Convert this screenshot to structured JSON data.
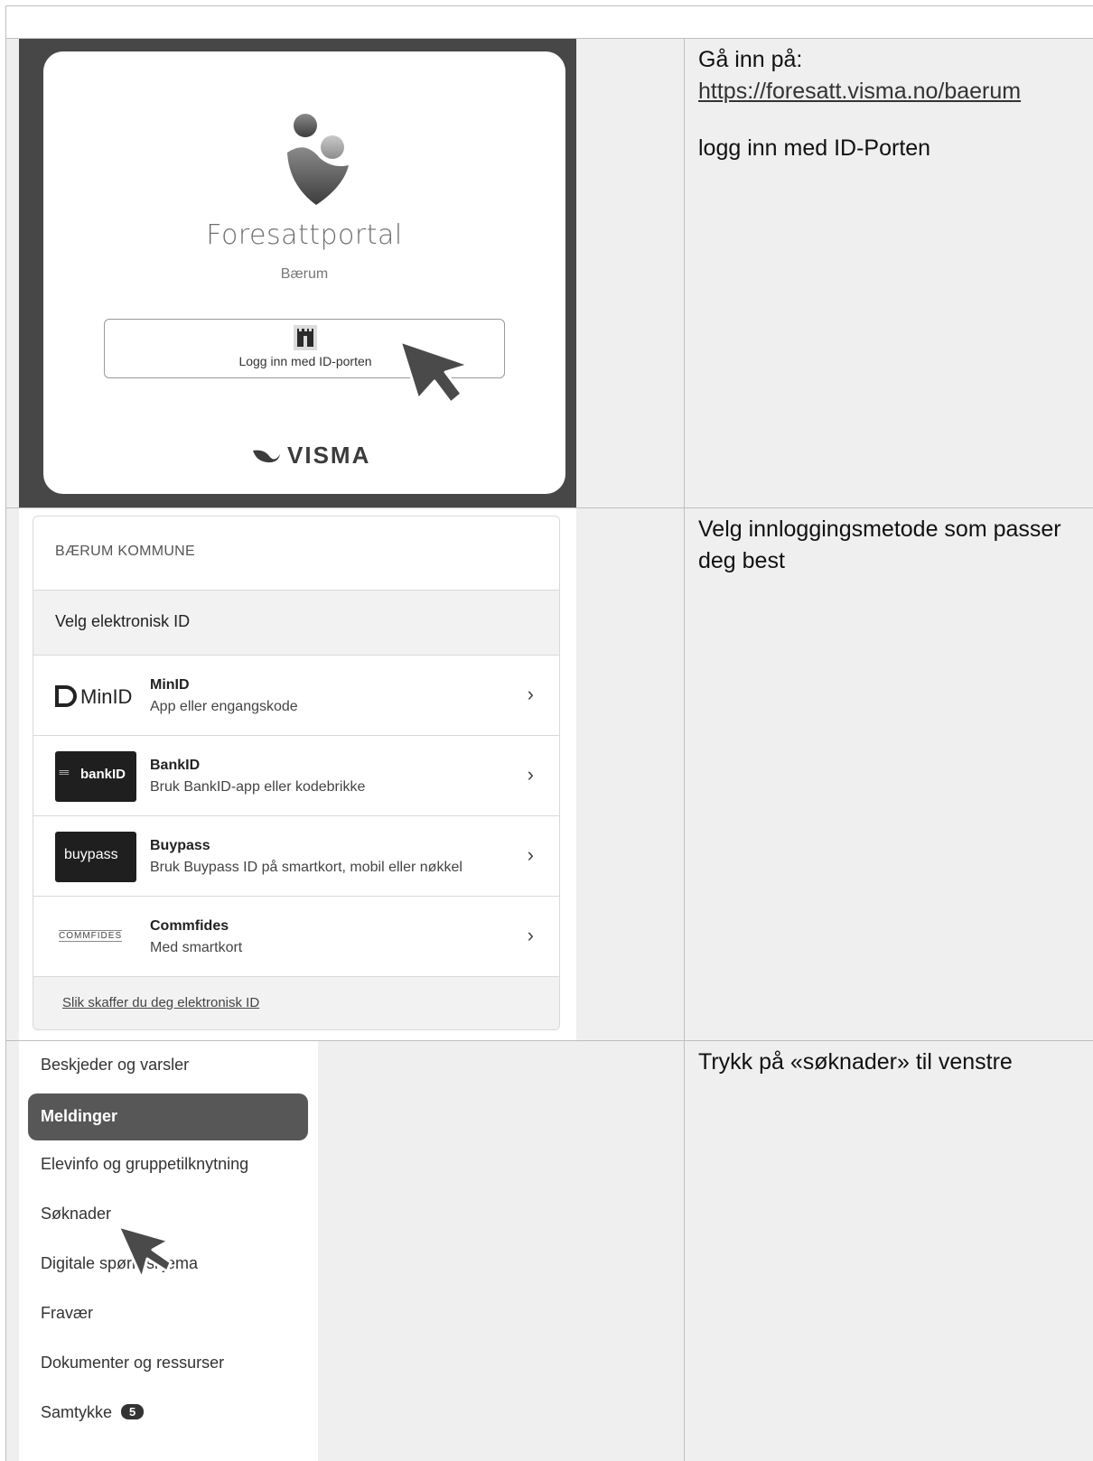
{
  "rows": [
    {
      "instruction_line1": "Gå inn på:",
      "instruction_link": "https://foresatt.visma.no/baerum",
      "instruction_line3": "logg inn med ID-Porten",
      "screenshot": {
        "portal_title": "Foresattportal",
        "portal_subtitle": "Bærum",
        "login_button_label": "Logg inn med ID-porten",
        "brand": "VISMA"
      }
    },
    {
      "instruction": "Velg innloggingsmetode som passer deg best",
      "screenshot": {
        "municipality": "BÆRUM KOMMUNE",
        "choose_label": "Velg elektronisk ID",
        "options": [
          {
            "logo_text": "MinID",
            "name": "MinID",
            "desc": "App eller engangskode"
          },
          {
            "logo_text": "bankID",
            "name": "BankID",
            "desc": "Bruk BankID-app eller kodebrikke"
          },
          {
            "logo_text": "buypass",
            "name": "Buypass",
            "desc": "Bruk Buypass ID på smartkort, mobil eller nøkkel"
          },
          {
            "logo_text": "COMMFIDES",
            "name": "Commfides",
            "desc": "Med smartkort"
          }
        ],
        "footer_link": "Slik skaffer du deg elektronisk ID"
      }
    },
    {
      "instruction": "Trykk på «søknader» til venstre",
      "screenshot": {
        "nav_items": [
          {
            "label": "Beskjeder og varsler"
          },
          {
            "label": "Meldinger",
            "active": true
          },
          {
            "label": "Elevinfo og gruppetilknytning"
          },
          {
            "label": "Søknader"
          },
          {
            "label": "Digitale spørreskjema"
          },
          {
            "label": "Fravær"
          },
          {
            "label": "Dokumenter og ressurser"
          },
          {
            "label": "Samtykke",
            "badge": "5"
          }
        ]
      }
    }
  ]
}
